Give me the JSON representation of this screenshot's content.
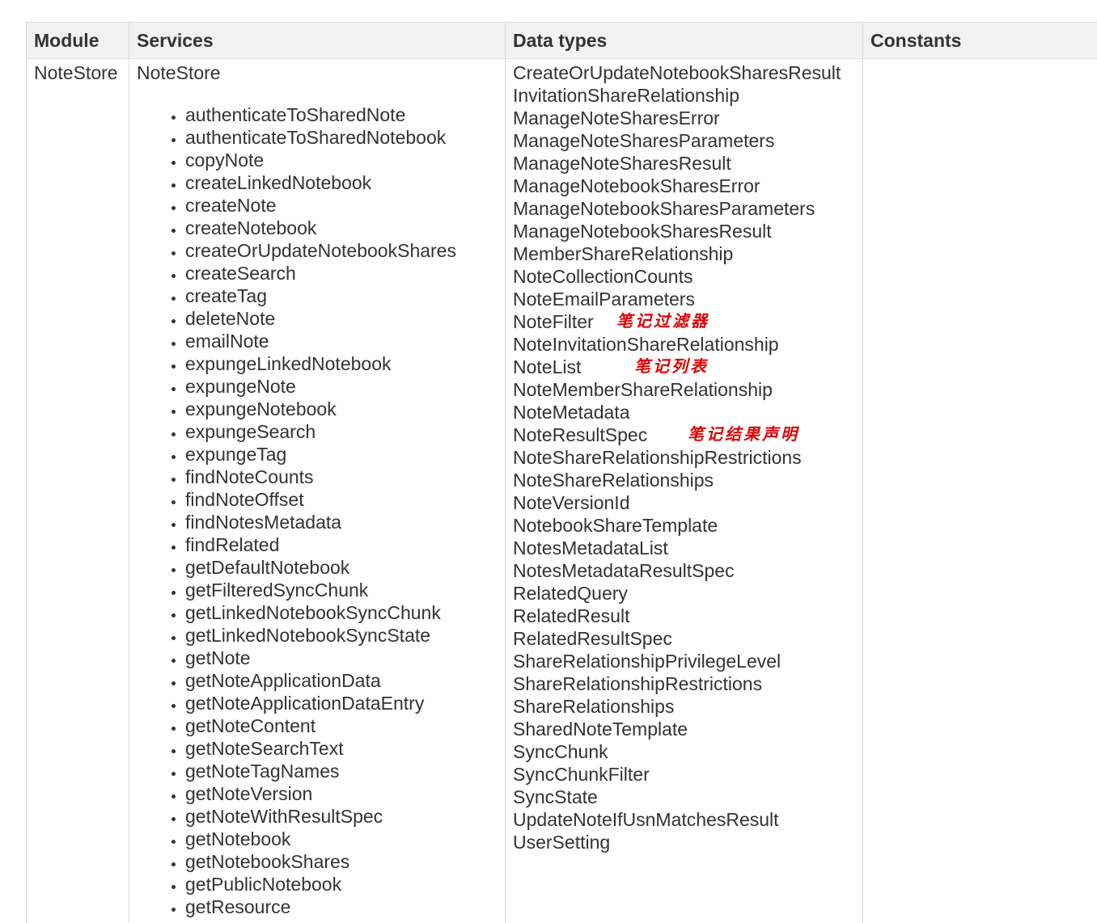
{
  "table": {
    "headers": {
      "module": "Module",
      "services": "Services",
      "datatypes": "Data types",
      "constants": "Constants"
    },
    "row": {
      "module": "NoteStore",
      "service_title": "NoteStore",
      "services": [
        "authenticateToSharedNote",
        "authenticateToSharedNotebook",
        "copyNote",
        "createLinkedNotebook",
        "createNote",
        "createNotebook",
        "createOrUpdateNotebookShares",
        "createSearch",
        "createTag",
        "deleteNote",
        "emailNote",
        "expungeLinkedNotebook",
        "expungeNote",
        "expungeNotebook",
        "expungeSearch",
        "expungeTag",
        "findNoteCounts",
        "findNoteOffset",
        "findNotesMetadata",
        "findRelated",
        "getDefaultNotebook",
        "getFilteredSyncChunk",
        "getLinkedNotebookSyncChunk",
        "getLinkedNotebookSyncState",
        "getNote",
        "getNoteApplicationData",
        "getNoteApplicationDataEntry",
        "getNoteContent",
        "getNoteSearchText",
        "getNoteTagNames",
        "getNoteVersion",
        "getNoteWithResultSpec",
        "getNotebook",
        "getNotebookShares",
        "getPublicNotebook",
        "getResource"
      ],
      "datatypes": [
        "CreateOrUpdateNotebookSharesResult",
        "InvitationShareRelationship",
        "ManageNoteSharesError",
        "ManageNoteSharesParameters",
        "ManageNoteSharesResult",
        "ManageNotebookSharesError",
        "ManageNotebookSharesParameters",
        "ManageNotebookSharesResult",
        "MemberShareRelationship",
        "NoteCollectionCounts",
        "NoteEmailParameters",
        "NoteFilter",
        "NoteInvitationShareRelationship",
        "NoteList",
        "NoteMemberShareRelationship",
        "NoteMetadata",
        "NoteResultSpec",
        "NoteShareRelationshipRestrictions",
        "NoteShareRelationships",
        "NoteVersionId",
        "NotebookShareTemplate",
        "NotesMetadataList",
        "NotesMetadataResultSpec",
        "RelatedQuery",
        "RelatedResult",
        "RelatedResultSpec",
        "ShareRelationshipPrivilegeLevel",
        "ShareRelationshipRestrictions",
        "ShareRelationships",
        "SharedNoteTemplate",
        "SyncChunk",
        "SyncChunkFilter",
        "SyncState",
        "UpdateNoteIfUsnMatchesResult",
        "UserSetting"
      ],
      "constants": ""
    }
  },
  "annotations": {
    "note_filter": "笔记过滤器",
    "note_list": "笔记列表",
    "note_result_spec": "笔记结果声明",
    "color": "#e00000"
  }
}
